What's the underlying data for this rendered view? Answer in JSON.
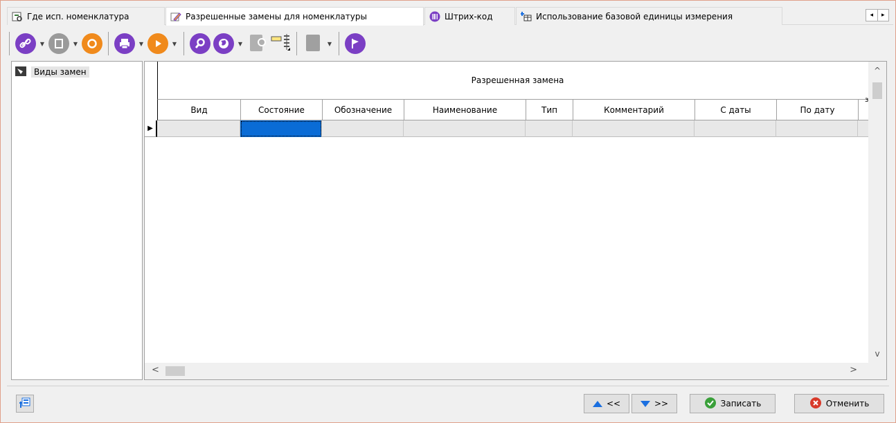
{
  "tabs": [
    {
      "label": "Где исп. номенклатура",
      "icon": "where-used-icon",
      "active": false
    },
    {
      "label": "Разрешенные замены для номенклатуры",
      "icon": "edit-replacement-icon",
      "active": true
    },
    {
      "label": "Штрих-код",
      "icon": "barcode-icon",
      "active": false
    },
    {
      "label": "Использование базовой единицы измерения",
      "icon": "base-unit-icon",
      "active": false
    }
  ],
  "tab_scroll": {
    "left": "◂",
    "right": "▸"
  },
  "toolbar": {
    "icons": [
      "link-icon",
      "document-icon",
      "refresh-icon",
      "print-icon",
      "play-icon",
      "search-icon",
      "globe-icon",
      "export-icon",
      "columns-icon",
      "report-icon",
      "flag-icon"
    ]
  },
  "tree": {
    "items": [
      {
        "label": "Виды замен",
        "icon": "replacement-types-icon"
      }
    ]
  },
  "grid": {
    "band_header": "Разрешенная замена",
    "band_overflow": "з:",
    "columns": [
      "Вид",
      "Состояние",
      "Обозначение",
      "Наименование",
      "Тип",
      "Комментарий",
      "С даты",
      "По дату"
    ],
    "row_indicator": "▶"
  },
  "scroll": {
    "up": "^",
    "down": "v",
    "left": "<",
    "right": ">"
  },
  "footer": {
    "prev_label": "<<",
    "next_label": ">>",
    "save_label": "Записать",
    "cancel_label": "Отменить"
  },
  "colors": {
    "selection": "#0a6cd6",
    "save_green": "#3aa03a",
    "cancel_red": "#d83a2a",
    "toolbar_purple": "#7b3fc4",
    "toolbar_orange": "#f08a1c",
    "arrow_blue": "#1a6fe0"
  }
}
